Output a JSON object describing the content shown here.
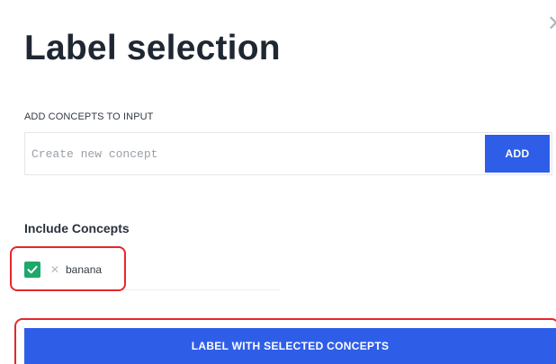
{
  "dialog": {
    "title": "Label selection",
    "close_icon": "close-icon"
  },
  "add_concepts": {
    "section_label": "ADD CONCEPTS TO INPUT",
    "input_placeholder": "Create new concept",
    "input_value": "",
    "add_button_label": "ADD"
  },
  "include_concepts": {
    "heading": "Include Concepts",
    "items": [
      {
        "label": "banana",
        "checked": true,
        "check_icon": "checkmark-icon",
        "remove_icon": "close-icon"
      }
    ]
  },
  "actions": {
    "label_button": "LABEL WITH SELECTED CONCEPTS"
  },
  "colors": {
    "primary": "#2e5ee8",
    "checkbox_checked": "#1ea86a",
    "highlight_annotation": "#e8262a"
  }
}
